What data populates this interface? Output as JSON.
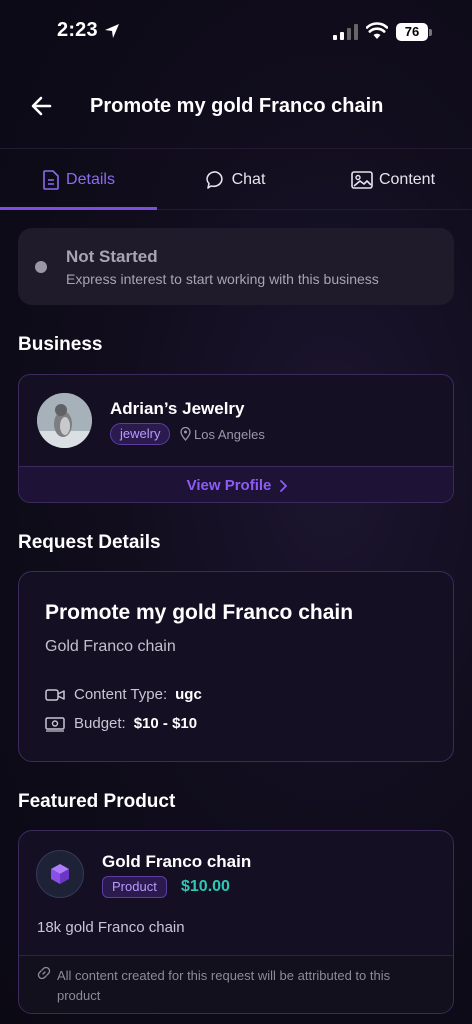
{
  "status_bar": {
    "time": "2:23",
    "battery": "76"
  },
  "header": {
    "title": "Promote my gold Franco chain"
  },
  "tabs": [
    {
      "label": "Details",
      "active": true
    },
    {
      "label": "Chat",
      "active": false
    },
    {
      "label": "Content",
      "active": false
    }
  ],
  "request_status": {
    "title": "Not Started",
    "subtitle": "Express interest to start working with this business"
  },
  "business_section": {
    "heading": "Business",
    "name": "Adrian’s Jewelry",
    "tag": "jewelry",
    "location": "Los Angeles",
    "view_profile": "View Profile"
  },
  "request_details": {
    "heading": "Request Details",
    "title": "Promote my gold Franco chain",
    "subtitle": "Gold Franco chain",
    "content_type_label": "Content Type:",
    "content_type_value": "ugc",
    "budget_label": "Budget:",
    "budget_value": "$10 - $10"
  },
  "featured_product": {
    "heading": "Featured Product",
    "name": "Gold Franco chain",
    "badge": "Product",
    "price": "$10.00",
    "description": "18k gold Franco chain",
    "footer_note": "All content created for this request will be attributed to this product"
  },
  "colors": {
    "accent": "#8b6cf0",
    "price": "#2dc7b4",
    "background": "#0d0a17"
  }
}
